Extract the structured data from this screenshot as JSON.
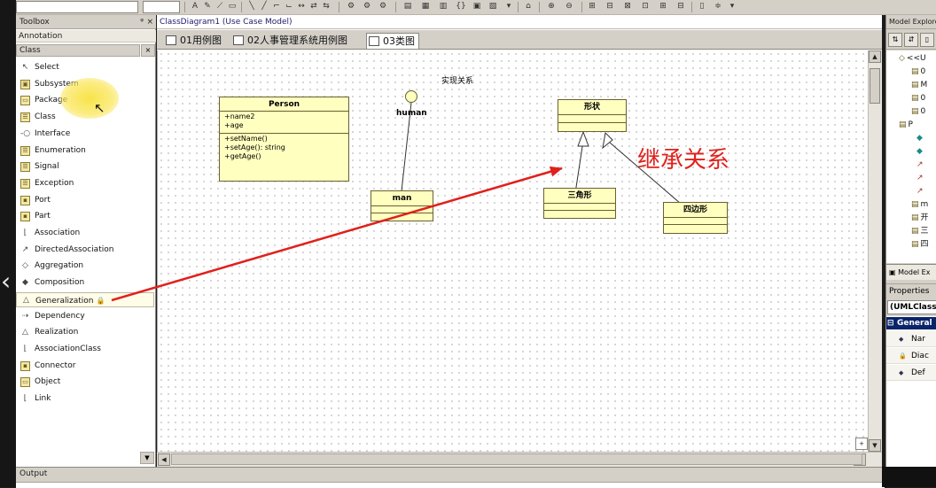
{
  "toolbox": {
    "title": "Toolbox",
    "pin_glyph": "ᵠ",
    "close_glyph": "×",
    "section": "Annotation",
    "category": "Class",
    "items": [
      {
        "label": "Select",
        "icon": "arrow-pointer-icon",
        "glyph": "↖"
      },
      {
        "label": "Subsystem",
        "icon": "subsystem-icon",
        "glyph": "▣"
      },
      {
        "label": "Package",
        "icon": "package-icon",
        "glyph": "▭"
      },
      {
        "label": "Class",
        "icon": "class-icon",
        "glyph": "☰"
      },
      {
        "label": "Interface",
        "icon": "interface-icon",
        "glyph": "-○"
      },
      {
        "label": "Enumeration",
        "icon": "enumeration-icon",
        "glyph": "☰"
      },
      {
        "label": "Signal",
        "icon": "signal-icon",
        "glyph": "☰"
      },
      {
        "label": "Exception",
        "icon": "exception-icon",
        "glyph": "☰"
      },
      {
        "label": "Port",
        "icon": "port-icon",
        "glyph": "▪"
      },
      {
        "label": "Part",
        "icon": "part-icon",
        "glyph": "▪"
      },
      {
        "label": "Association",
        "icon": "association-icon",
        "glyph": "⌊"
      },
      {
        "label": "DirectedAssociation",
        "icon": "directed-association-icon",
        "glyph": "↗"
      },
      {
        "label": "Aggregation",
        "icon": "aggregation-icon",
        "glyph": "◇"
      },
      {
        "label": "Composition",
        "icon": "composition-icon",
        "glyph": "◆"
      },
      {
        "label": "Generalization",
        "icon": "generalization-icon",
        "glyph": "△"
      },
      {
        "label": "Dependency",
        "icon": "dependency-icon",
        "glyph": "⇢"
      },
      {
        "label": "Realization",
        "icon": "realization-icon",
        "glyph": "△"
      },
      {
        "label": "AssociationClass",
        "icon": "association-class-icon",
        "glyph": "⌊"
      },
      {
        "label": "Connector",
        "icon": "connector-icon",
        "glyph": "▪"
      },
      {
        "label": "Object",
        "icon": "object-icon",
        "glyph": "▭"
      },
      {
        "label": "Link",
        "icon": "link-icon",
        "glyph": "⌊"
      }
    ],
    "selected_index": 14,
    "lock_glyph": "🔒"
  },
  "document": {
    "title": "ClassDiagram1 (Use Case Model)",
    "tabs": [
      {
        "label": "01用例图",
        "icon": "diagram-icon"
      },
      {
        "label": "02人事管理系统用例图",
        "icon": "diagram-icon"
      },
      {
        "label": "03类图",
        "icon": "diagram-icon"
      }
    ],
    "active_tab": 2,
    "add_glyph": "+"
  },
  "diagram": {
    "label": "实现关系",
    "annotation": "继承关系",
    "actor": {
      "name": "human"
    },
    "classes": {
      "person": {
        "name": "Person",
        "attributes": [
          "+name2",
          "+age"
        ],
        "operations": [
          "+setName()",
          "+setAge(): string",
          "+getAge()"
        ]
      },
      "man": {
        "name": "man"
      },
      "shape": {
        "name": "形状"
      },
      "triangle": {
        "name": "三角形"
      },
      "quad": {
        "name": "四边形"
      }
    }
  },
  "model_explorer": {
    "title": "Model Explorer",
    "tree": [
      {
        "glyph": "◇",
        "label": "<<U"
      },
      {
        "glyph": "▤",
        "label": "0"
      },
      {
        "glyph": "▤",
        "label": "M"
      },
      {
        "glyph": "▤",
        "label": "0"
      },
      {
        "glyph": "▤",
        "label": "0"
      },
      {
        "glyph": "▤",
        "label": "P"
      },
      {
        "glyph": "◆",
        "label": ""
      },
      {
        "glyph": "◆",
        "label": ""
      },
      {
        "glyph": "↗",
        "label": ""
      },
      {
        "glyph": "↗",
        "label": ""
      },
      {
        "glyph": "↗",
        "label": ""
      },
      {
        "glyph": "▤",
        "label": "m"
      },
      {
        "glyph": "▤",
        "label": "开"
      },
      {
        "glyph": "▤",
        "label": "三"
      },
      {
        "glyph": "▤",
        "label": "四"
      }
    ],
    "tab_label": "Model Ex"
  },
  "properties": {
    "title": "Properties",
    "object": "(UMLClass",
    "category": "General",
    "rows": [
      {
        "icon": "◆",
        "label": "Nar"
      },
      {
        "icon": "🔒",
        "label": "Diac"
      },
      {
        "icon": "◆",
        "label": "Def"
      }
    ]
  },
  "output": {
    "title": "Output"
  },
  "colors": {
    "uml_fill": "#ffffc0",
    "annotation_red": "#e0211c",
    "selection_blue": "#0a246a"
  }
}
